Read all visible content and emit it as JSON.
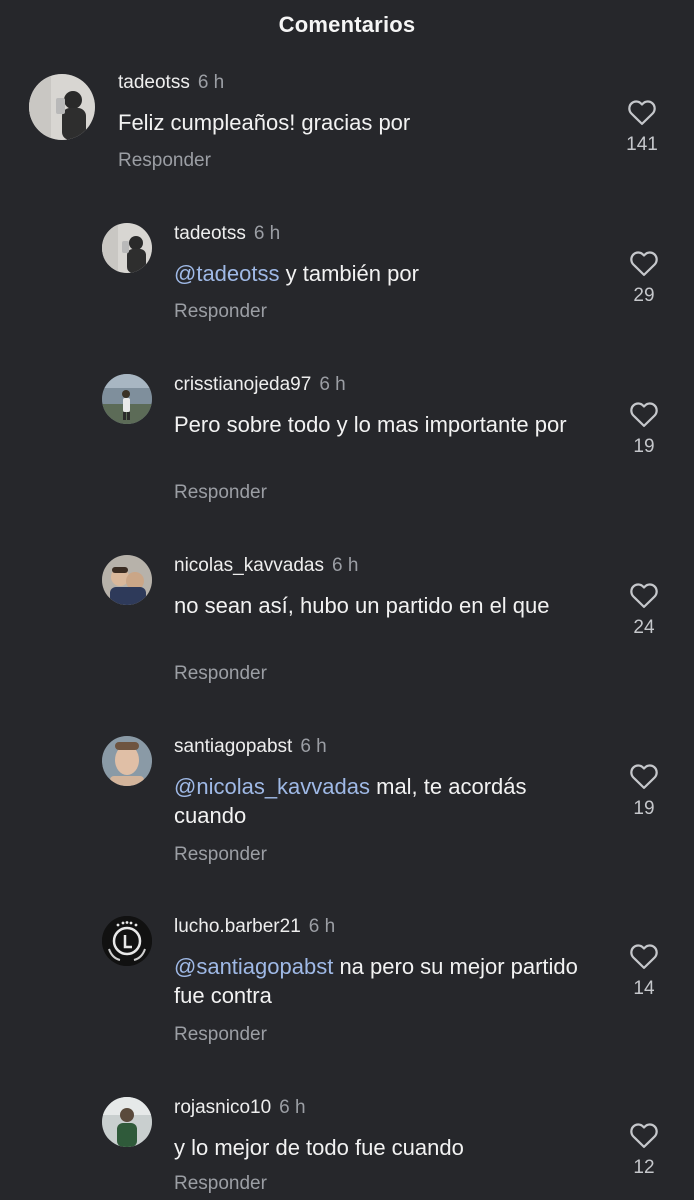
{
  "header": {
    "title": "Comentarios"
  },
  "comments": [
    {
      "username": "tadeotss",
      "time": "6 h",
      "mention": "",
      "text": "Feliz cumpleaños! gracias por",
      "reply": "Responder",
      "likes": "141"
    },
    {
      "username": "tadeotss",
      "time": "6 h",
      "mention": "@tadeotss",
      "text": " y también por",
      "reply": "Responder",
      "likes": "29"
    },
    {
      "username": "crisstianojeda97",
      "time": "6 h",
      "mention": "",
      "text": "Pero sobre todo y lo mas importante por",
      "reply": "Responder",
      "likes": "19"
    },
    {
      "username": "nicolas_kavvadas",
      "time": "6 h",
      "mention": "",
      "text": "no sean así, hubo un partido en el que",
      "reply": "Responder",
      "likes": "24"
    },
    {
      "username": "santiagopabst",
      "time": "6 h",
      "mention": "@nicolas_kavvadas",
      "text": " mal, te acordás cuando",
      "reply": "Responder",
      "likes": "19"
    },
    {
      "username": "lucho.barber21",
      "time": "6 h",
      "mention": "@santiagopabst",
      "text": " na pero su mejor partido fue contra",
      "reply": "Responder",
      "likes": "14"
    },
    {
      "username": "rojasnico10",
      "time": "6 h",
      "mention": "",
      "text": "y lo mejor de todo fue cuando",
      "reply": "Responder",
      "likes": "12"
    }
  ],
  "icons": {
    "like": "heart-outline-icon"
  },
  "colors": {
    "background": "#26272b",
    "mention": "#9fb9e6",
    "secondary_text": "#9b9ea4"
  }
}
